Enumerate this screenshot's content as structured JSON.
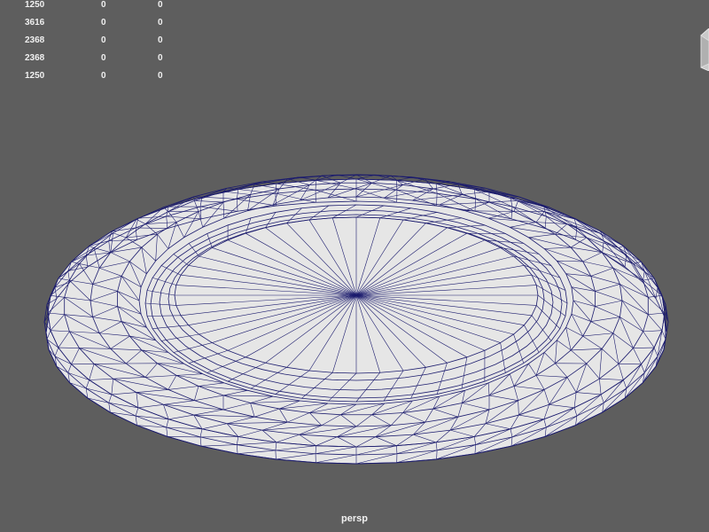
{
  "hud": {
    "rows": [
      [
        "1250",
        "0",
        "0"
      ],
      [
        "3616",
        "0",
        "0"
      ],
      [
        "2368",
        "0",
        "0"
      ],
      [
        "2368",
        "0",
        "0"
      ],
      [
        "1250",
        "0",
        "0"
      ]
    ]
  },
  "camera": {
    "label": "persp"
  },
  "colors": {
    "background": "#5e5e5e",
    "mesh_fill": "#e6e6e6",
    "wireframe": "#1c1c6e",
    "hud_text": "#f0f0f0"
  },
  "icons": {
    "view_cube": "view-cube-icon"
  }
}
